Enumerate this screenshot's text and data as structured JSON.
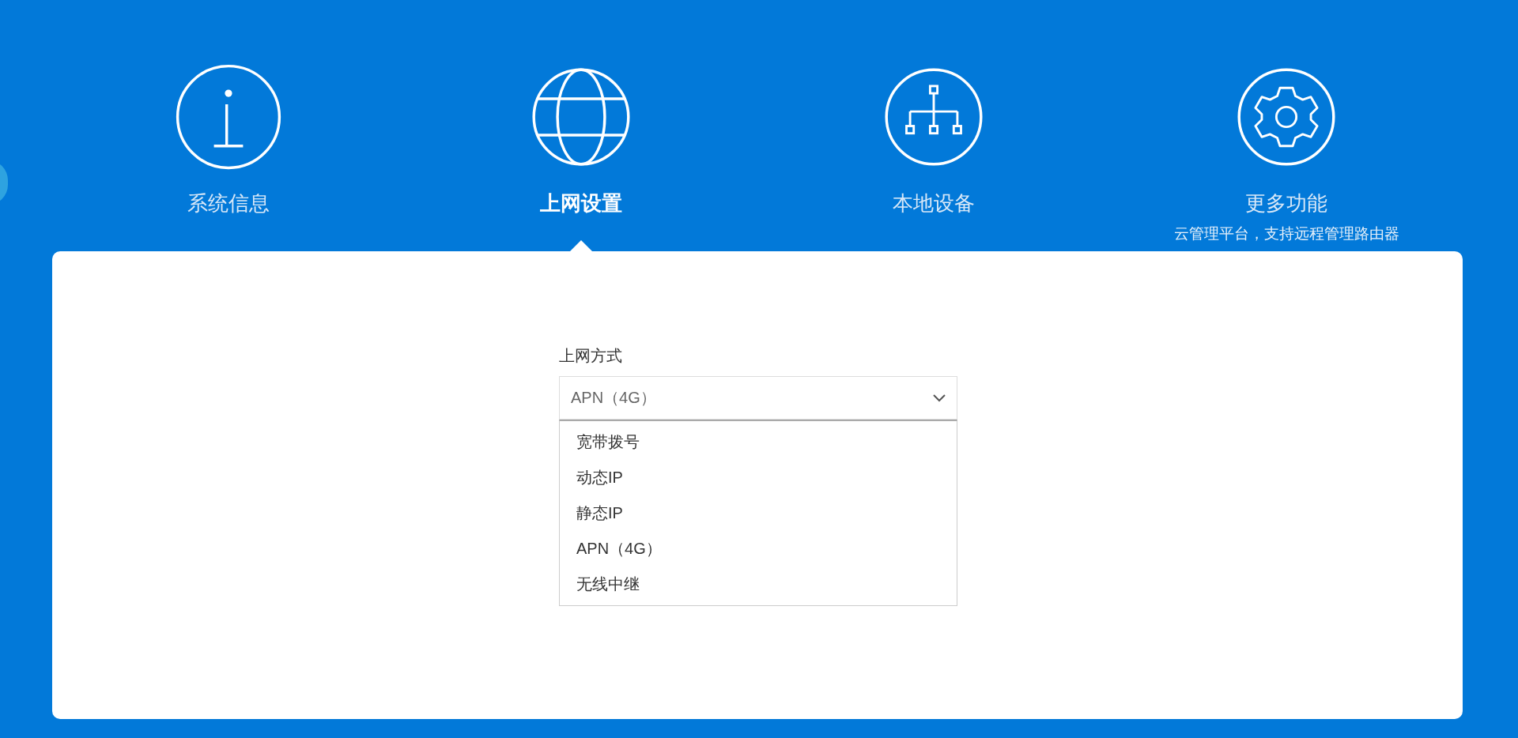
{
  "nav_tabs": [
    {
      "kind": "info",
      "label": "系统信息",
      "selected": false
    },
    {
      "kind": "globe",
      "label": "上网设置",
      "selected": true
    },
    {
      "kind": "network",
      "label": "本地设备",
      "selected": false
    },
    {
      "kind": "gear",
      "label": "更多功能",
      "subtitle": "云管理平台，支持远程管理路由器",
      "selected": false
    }
  ],
  "form": {
    "label": "上网方式",
    "select": {
      "value": "APN（4G）",
      "expanded": true,
      "options": [
        "宽带拨号",
        "动态IP",
        "静态IP",
        "APN（4G）",
        "无线中继"
      ]
    }
  }
}
